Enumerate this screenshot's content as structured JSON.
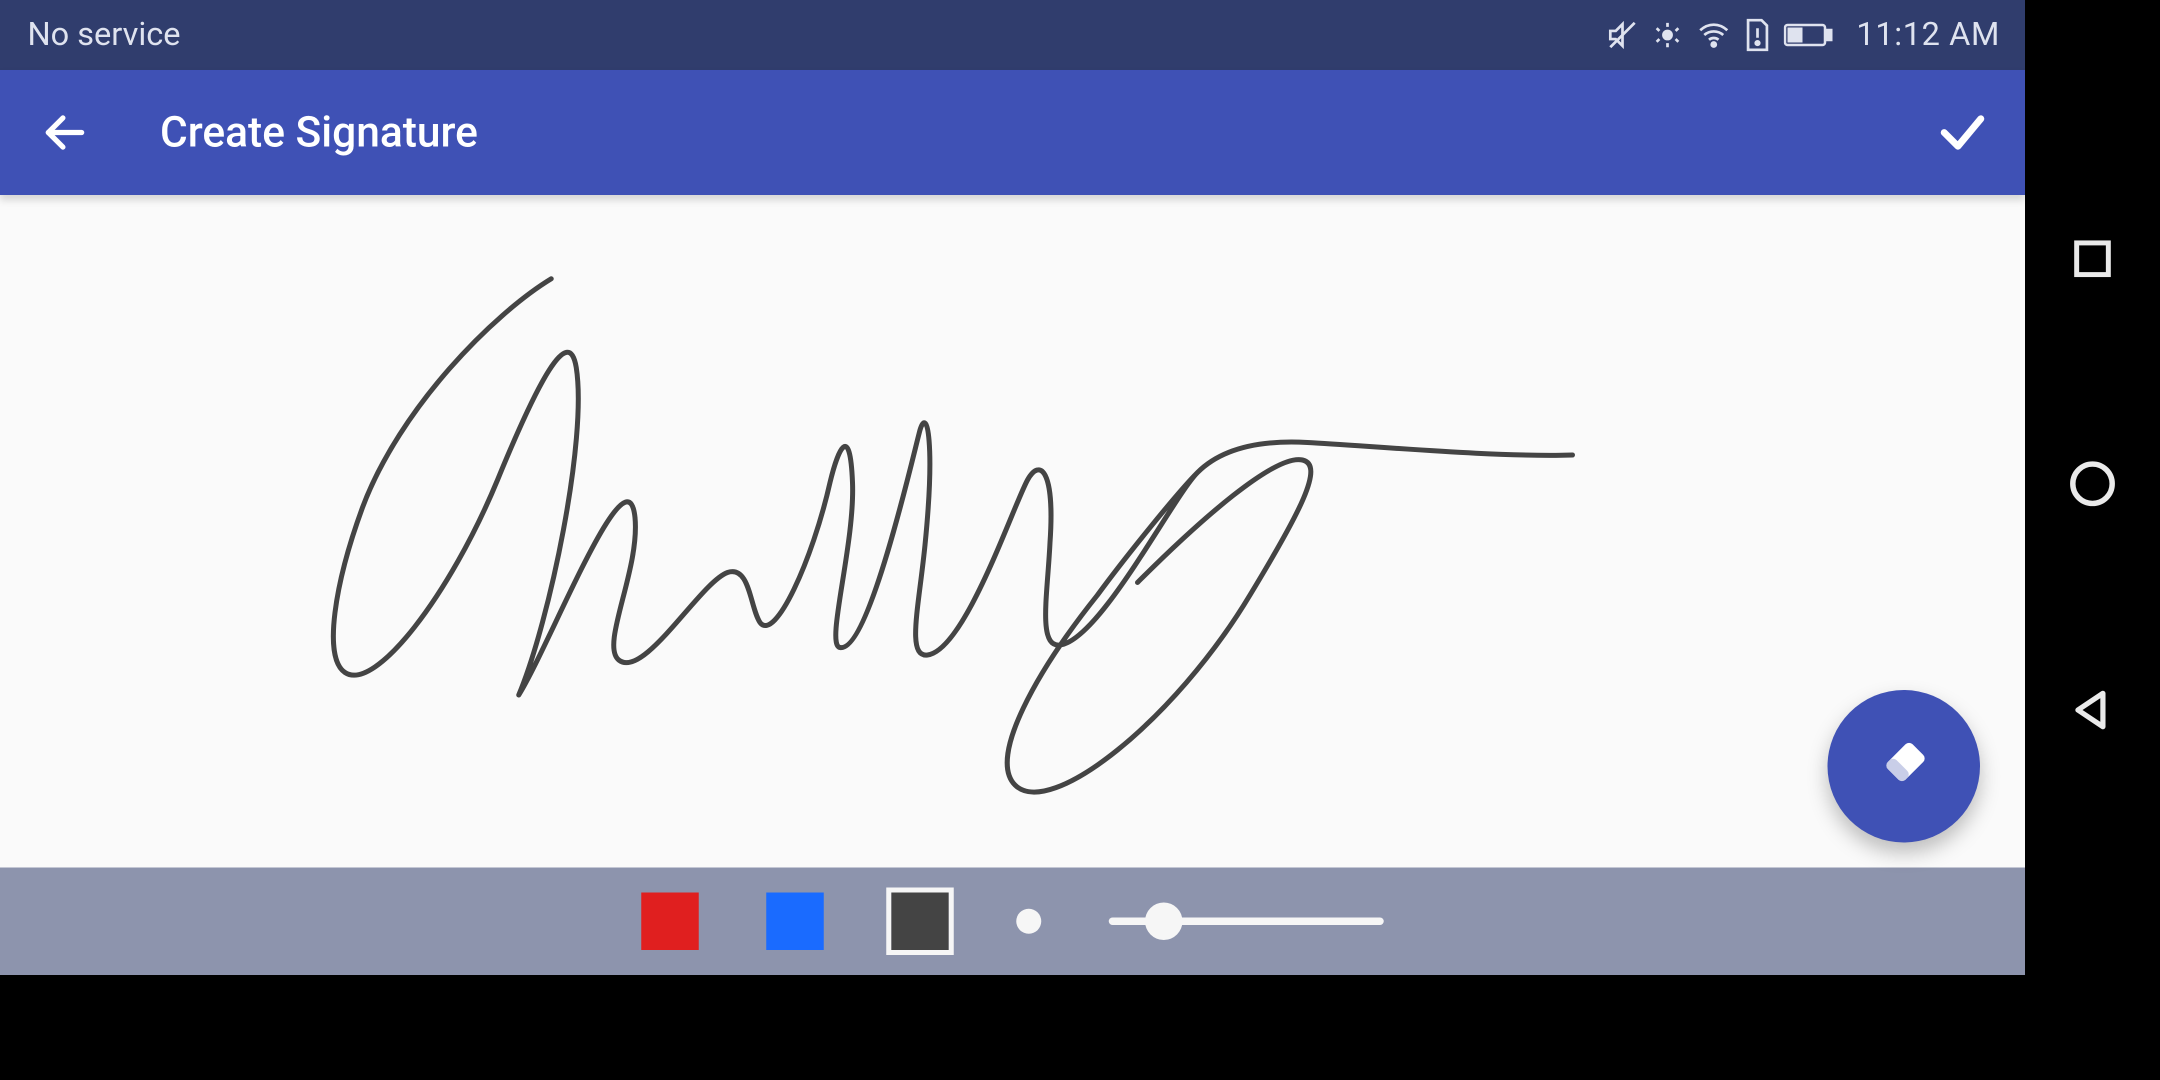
{
  "status": {
    "carrier": "No service",
    "time": "11:12 AM",
    "icons": [
      "mute-icon",
      "eye-icon",
      "wifi-icon",
      "sim-alert-icon",
      "battery-icon"
    ]
  },
  "appbar": {
    "title": "Create Signature"
  },
  "toolbar": {
    "colors": [
      {
        "name": "red",
        "hex": "#e01f1f",
        "selected": false
      },
      {
        "name": "blue",
        "hex": "#1a6bff",
        "selected": false
      },
      {
        "name": "black",
        "hex": "#444444",
        "selected": true
      }
    ],
    "thickness_percent": 20
  },
  "fab": {
    "label": "Erase"
  },
  "signature": {
    "stroke_color": "#444444",
    "stroke_width": 4
  }
}
